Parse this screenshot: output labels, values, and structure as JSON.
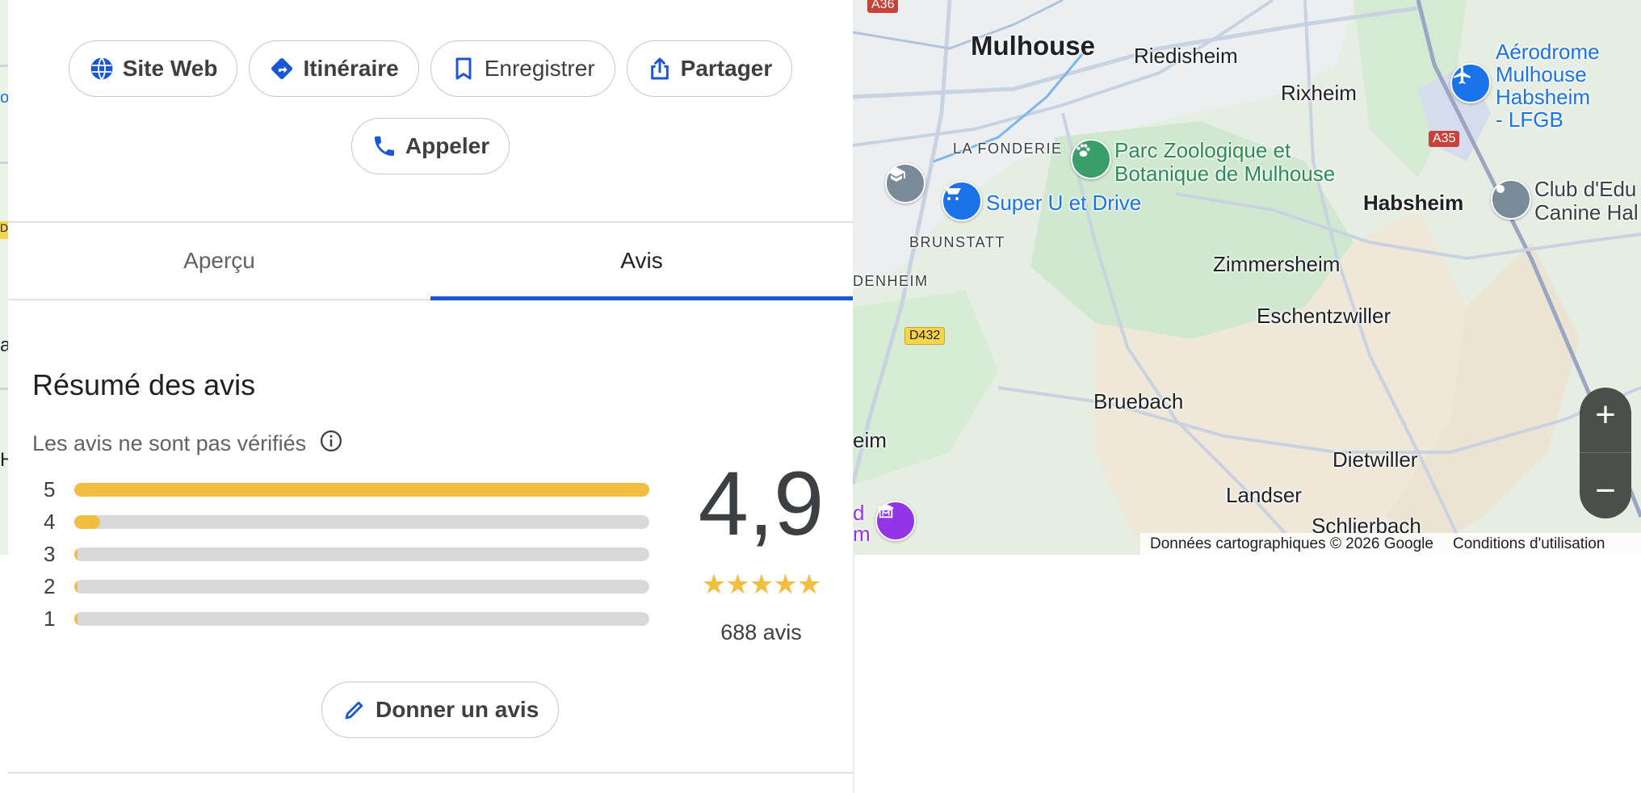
{
  "actions": {
    "website": "Site Web",
    "directions": "Itinéraire",
    "save": "Enregistrer",
    "share": "Partager",
    "call": "Appeler"
  },
  "tabs": [
    {
      "label": "Aperçu",
      "active": false
    },
    {
      "label": "Avis",
      "active": true
    }
  ],
  "reviews": {
    "title": "Résumé des avis",
    "unverified_note": "Les avis ne sont pas vérifiés",
    "distribution": [
      {
        "stars": "5",
        "fraction": 1.0
      },
      {
        "stars": "4",
        "fraction": 0.045
      },
      {
        "stars": "3",
        "fraction": 0.004
      },
      {
        "stars": "2",
        "fraction": 0.004
      },
      {
        "stars": "1",
        "fraction": 0.006
      }
    ],
    "average": "4,9",
    "stars_display": "★★★★★",
    "count": "688 avis",
    "write_review": "Donner un avis"
  },
  "map": {
    "places": {
      "mulhouse": "Mulhouse",
      "riedisheim": "Riedisheim",
      "rixheim": "Rixheim",
      "aerodrome": [
        "Aérodrome",
        "Mulhouse",
        "Habsheim",
        "- LFGB"
      ],
      "la_fonderie": "LA FONDERIE",
      "parc_zoo": [
        "Parc Zoologique et",
        "Botanique de Mulhouse"
      ],
      "super_u": "Super U et Drive",
      "habsheim": "Habsheim",
      "club": [
        "Club d'Edu",
        "Canine Hal"
      ],
      "brunstatt": "BRUNSTATT",
      "zimmersheim": "Zimmersheim",
      "denheim": "DENHEIM",
      "eschentzwiller": "Eschentzwiller",
      "bruebach": "Bruebach",
      "eim": "eim",
      "dietwiller": "Dietwiller",
      "landser": "Landser",
      "schlierbach": "Schlierbach",
      "d_m": [
        "d",
        "m"
      ]
    },
    "road_shields": {
      "a36": "A36",
      "a35": "A35",
      "d432": "D432"
    },
    "zoom_in": "+",
    "zoom_out": "−",
    "attribution": "Données cartographiques © 2026 Google",
    "terms": "Conditions d'utilisation"
  },
  "sliver": {
    "letters": [
      "oo",
      "D",
      "a",
      "H"
    ]
  },
  "colors": {
    "accent_blue": "#1a57d6",
    "star_yellow": "#f2be42",
    "bar_grey": "#d9d9d9"
  }
}
